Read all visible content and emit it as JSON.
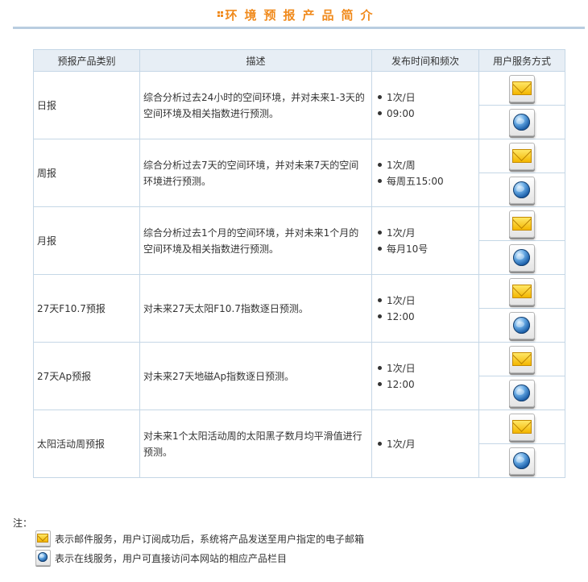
{
  "page": {
    "title": "环境预报产品简介"
  },
  "table": {
    "headers": [
      "预报产品类别",
      "描述",
      "发布时间和频次",
      "用户服务方式"
    ],
    "rows": [
      {
        "category": "日报",
        "description": "综合分析过去24小时的空间环境，并对未来1-3天的空间环境及相关指数进行预测。",
        "frequency": [
          "1次/日",
          "09:00"
        ]
      },
      {
        "category": "周报",
        "description": "综合分析过去7天的空间环境，并对未来7天的空间环境进行预测。",
        "frequency": [
          "1次/周",
          "每周五15:00"
        ]
      },
      {
        "category": "月报",
        "description": "综合分析过去1个月的空间环境，并对未来1个月的空间环境及相关指数进行预测。",
        "frequency": [
          "1次/月",
          "每月10号"
        ]
      },
      {
        "category": "27天F10.7预报",
        "description": "对未来27天太阳F10.7指数逐日预测。",
        "frequency": [
          "1次/日",
          "12:00"
        ]
      },
      {
        "category": "27天Ap预报",
        "description": "对未来27天地磁Ap指数逐日预测。",
        "frequency": [
          "1次/日",
          "12:00"
        ]
      },
      {
        "category": "太阳活动周预报",
        "description": "对未来1个太阳活动周的太阳黑子数月均平滑值进行预测。",
        "frequency": [
          "1次/月"
        ]
      }
    ],
    "service_icons": [
      "mail-icon",
      "globe-icon"
    ]
  },
  "notes": {
    "label": "注：",
    "items": [
      {
        "icon": "mail-icon",
        "text": "表示邮件服务，用户订阅成功后，系统将产品发送至用户指定的电子邮箱"
      },
      {
        "icon": "globe-icon",
        "text": "表示在线服务，用户可直接访问本网站的相应产品栏目"
      }
    ]
  },
  "colors": {
    "title": "#f08a1c",
    "rule": "#b9cde0",
    "table_header_bg": "#e7eef5",
    "table_border": "#c5d7e6"
  }
}
